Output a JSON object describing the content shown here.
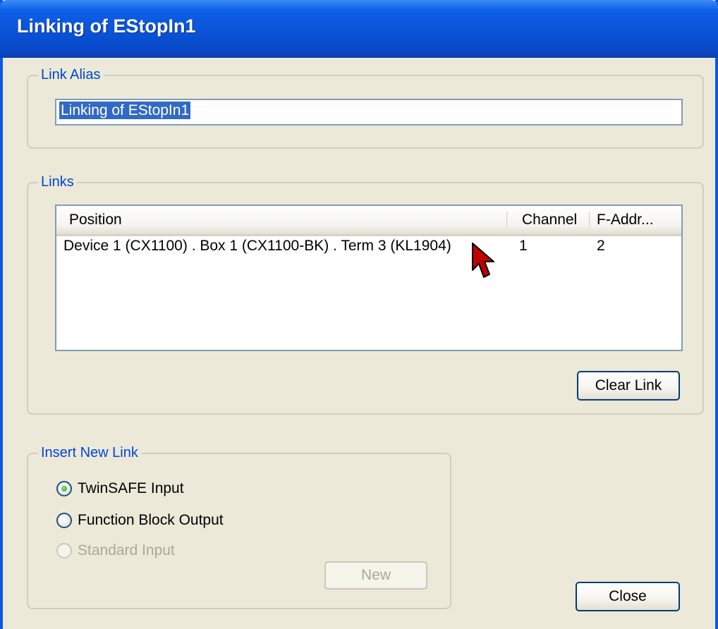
{
  "window": {
    "title": "Linking of EStopIn1"
  },
  "link_alias": {
    "group_label": "Link Alias",
    "value": "Linking of EStopIn1"
  },
  "links": {
    "group_label": "Links",
    "columns": [
      "Position",
      "Channel",
      "F-Addr..."
    ],
    "rows": [
      {
        "position": "Device 1 (CX1100) . Box 1 (CX1100-BK) . Term 3 (KL1904)",
        "channel": "1",
        "f_addr": "2"
      }
    ],
    "clear_button": "Clear Link"
  },
  "insert_new_link": {
    "group_label": "Insert New Link",
    "options": [
      {
        "label": "TwinSAFE Input",
        "selected": true,
        "enabled": true
      },
      {
        "label": "Function Block Output",
        "selected": false,
        "enabled": true
      },
      {
        "label": "Standard Input",
        "selected": false,
        "enabled": false
      }
    ],
    "new_button": "New"
  },
  "close_button": "Close",
  "colors": {
    "title_bar": "#0A53D8",
    "window_bg": "#ECE9D8",
    "group_label": "#0046D5",
    "selection": "#316AC5",
    "radio_dot": "#21A121"
  },
  "icons": {
    "cursor": "mouse-pointer-icon"
  }
}
